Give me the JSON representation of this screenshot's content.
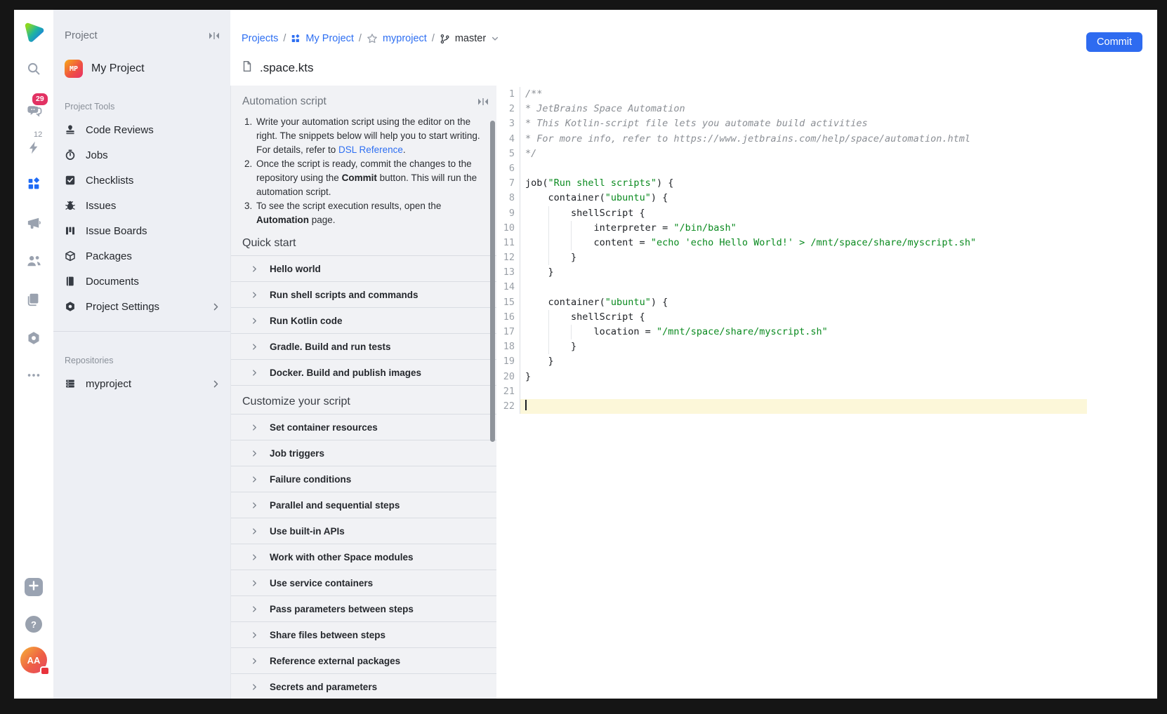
{
  "rail": {
    "badges": {
      "chats": "29",
      "automation": "12"
    },
    "help_label": "?",
    "avatar_initials": "AA"
  },
  "sidebar": {
    "header": "Project",
    "project": {
      "name": "My Project",
      "abbr": "MP"
    },
    "sections": [
      {
        "label": "Project Tools",
        "items": [
          {
            "label": "Code Reviews",
            "icon": "stamp"
          },
          {
            "label": "Jobs",
            "icon": "timer"
          },
          {
            "label": "Checklists",
            "icon": "checklist"
          },
          {
            "label": "Issues",
            "icon": "bug"
          },
          {
            "label": "Issue Boards",
            "icon": "board"
          },
          {
            "label": "Packages",
            "icon": "package"
          },
          {
            "label": "Documents",
            "icon": "document"
          },
          {
            "label": "Project Settings",
            "icon": "nut",
            "chevron": true
          }
        ]
      },
      {
        "label": "Repositories",
        "items": [
          {
            "label": "myproject",
            "icon": "repo",
            "chevron": true
          }
        ]
      }
    ]
  },
  "breadcrumb": {
    "separator": "/",
    "items": [
      {
        "label": "Projects",
        "type": "link"
      },
      {
        "label": "My Project",
        "type": "link",
        "icon": "grid"
      },
      {
        "label": "myproject",
        "type": "link",
        "icon": "star"
      },
      {
        "label": "master",
        "type": "current",
        "icon": "branch",
        "chevron": true
      }
    ]
  },
  "file": {
    "name": ".space.kts"
  },
  "toolbar": {
    "commit_label": "Commit"
  },
  "panel": {
    "title": "Automation script",
    "steps": [
      [
        {
          "t": "Write your automation script using the editor on the right. The snippets below will help you to start writing. For details, refer to ",
          "k": "plain"
        },
        {
          "t": "DSL Reference",
          "k": "link"
        },
        {
          "t": ".",
          "k": "plain"
        }
      ],
      [
        {
          "t": "Once the script is ready, commit the changes to the repository using the ",
          "k": "plain"
        },
        {
          "t": "Commit",
          "k": "bold"
        },
        {
          "t": " button. This will run the automation script.",
          "k": "plain"
        }
      ],
      [
        {
          "t": "To see the script execution results, open the ",
          "k": "plain"
        },
        {
          "t": "Automation",
          "k": "bold"
        },
        {
          "t": " page.",
          "k": "plain"
        }
      ]
    ],
    "sections": [
      {
        "title": "Quick start",
        "items": [
          "Hello world",
          "Run shell scripts and commands",
          "Run Kotlin code",
          "Gradle. Build and run tests",
          "Docker. Build and publish images"
        ]
      },
      {
        "title": "Customize your script",
        "items": [
          "Set container resources",
          "Job triggers",
          "Failure conditions",
          "Parallel and sequential steps",
          "Use built-in APIs",
          "Work with other Space modules",
          "Use service containers",
          "Pass parameters between steps",
          "Share files between steps",
          "Reference external packages",
          "Secrets and parameters"
        ]
      }
    ]
  },
  "editor": {
    "lines": [
      {
        "n": 1,
        "tokens": [
          [
            "/**",
            "cm"
          ]
        ]
      },
      {
        "n": 2,
        "tokens": [
          [
            "* JetBrains Space Automation",
            "cm"
          ]
        ]
      },
      {
        "n": 3,
        "tokens": [
          [
            "* This Kotlin-script file lets you automate build activities",
            "cm"
          ]
        ]
      },
      {
        "n": 4,
        "tokens": [
          [
            "* For more info, refer to https://www.jetbrains.com/help/space/automation.html",
            "cm"
          ]
        ]
      },
      {
        "n": 5,
        "tokens": [
          [
            "*/",
            "cm"
          ]
        ]
      },
      {
        "n": 6,
        "tokens": []
      },
      {
        "n": 7,
        "tokens": [
          [
            "job(",
            "pl"
          ],
          [
            "\"Run shell scripts\"",
            "st"
          ],
          [
            ") {",
            "pl"
          ]
        ]
      },
      {
        "n": 8,
        "tokens": [
          [
            "    container(",
            "pl"
          ],
          [
            "\"ubuntu\"",
            "st"
          ],
          [
            ") {",
            "pl"
          ]
        ]
      },
      {
        "n": 9,
        "guides": [
          4
        ],
        "tokens": [
          [
            "        shellScript {",
            "pl"
          ]
        ]
      },
      {
        "n": 10,
        "guides": [
          4,
          8
        ],
        "tokens": [
          [
            "            interpreter = ",
            "pl"
          ],
          [
            "\"/bin/bash\"",
            "st"
          ]
        ]
      },
      {
        "n": 11,
        "guides": [
          4,
          8
        ],
        "tokens": [
          [
            "            content = ",
            "pl"
          ],
          [
            "\"echo 'echo Hello World!' > /mnt/space/share/myscript.sh\"",
            "st"
          ]
        ]
      },
      {
        "n": 12,
        "guides": [
          4
        ],
        "tokens": [
          [
            "        }",
            "pl"
          ]
        ]
      },
      {
        "n": 13,
        "tokens": [
          [
            "    }",
            "pl"
          ]
        ]
      },
      {
        "n": 14,
        "tokens": []
      },
      {
        "n": 15,
        "tokens": [
          [
            "    container(",
            "pl"
          ],
          [
            "\"ubuntu\"",
            "st"
          ],
          [
            ") {",
            "pl"
          ]
        ]
      },
      {
        "n": 16,
        "guides": [
          4
        ],
        "tokens": [
          [
            "        shellScript {",
            "pl"
          ]
        ]
      },
      {
        "n": 17,
        "guides": [
          4,
          8
        ],
        "tokens": [
          [
            "            location = ",
            "pl"
          ],
          [
            "\"/mnt/space/share/myscript.sh\"",
            "st"
          ]
        ]
      },
      {
        "n": 18,
        "guides": [
          4
        ],
        "tokens": [
          [
            "        }",
            "pl"
          ]
        ]
      },
      {
        "n": 19,
        "tokens": [
          [
            "    }",
            "pl"
          ]
        ]
      },
      {
        "n": 20,
        "tokens": [
          [
            "}",
            "pl"
          ]
        ]
      },
      {
        "n": 21,
        "tokens": []
      },
      {
        "n": 22,
        "tokens": [],
        "active": true
      }
    ]
  },
  "colors": {
    "accent_blue": "#2e6bf0",
    "link_blue": "#2e6ff2",
    "badge_pink": "#e23263",
    "string_green": "#0a8a1f",
    "active_line": "#fcf7d9"
  }
}
